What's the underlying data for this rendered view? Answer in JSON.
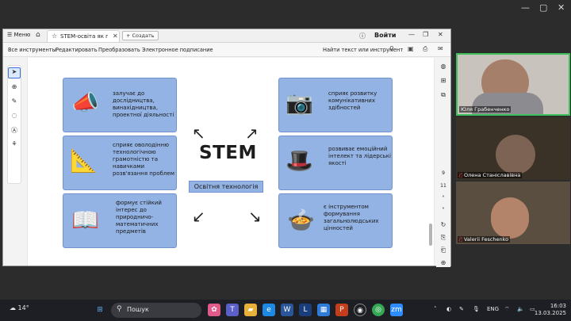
{
  "acrobat": {
    "menu_label": "Меню",
    "tab_title": "STEM-освіта як пла...",
    "create_label": "Создать",
    "login_label": "Войти",
    "toolbar": {
      "all_tools": "Все инструменты",
      "edit": "Редактировать",
      "convert": "Преобразовать",
      "esign": "Электронное подписание",
      "find": "Найти текст или инструмент"
    },
    "page_nums": [
      "9",
      "11"
    ]
  },
  "infographic": {
    "title": "STEM",
    "subtitle": "Освітня технологія",
    "cards": [
      {
        "text": "залучає до дослідництва, винахідництва, проектної діяльності",
        "icon": "person-megaphone-icon"
      },
      {
        "text": "сприяє оволодінню технологічною грамотністю та навичками розв'язання проблем",
        "icon": "person-drawing-icon"
      },
      {
        "text": "формує стійкий інтерес до природничо-математичних предметів",
        "icon": "person-reading-icon"
      },
      {
        "text": "сприяє розвитку комунікативних здібностей",
        "icon": "person-camera-icon"
      },
      {
        "text": "розвиває емоційний інтелект та лідерські якості",
        "icon": "person-phone-icon"
      },
      {
        "text": "є інструментом формування загальнолюдських цінностей",
        "icon": "person-cooking-icon"
      }
    ]
  },
  "participants": [
    {
      "name": "Юля Грабенченко",
      "muted": false
    },
    {
      "name": "Олена Станіславівна",
      "muted": true
    },
    {
      "name": "Valerii Feschenko",
      "muted": true
    }
  ],
  "taskbar": {
    "weather": "14°",
    "search_placeholder": "Пошук",
    "lang": "ENG",
    "time": "16:03",
    "date": "13.03.2025"
  },
  "colors": {
    "card_blue": "#93b3e4",
    "card_border": "#6f93cc"
  }
}
